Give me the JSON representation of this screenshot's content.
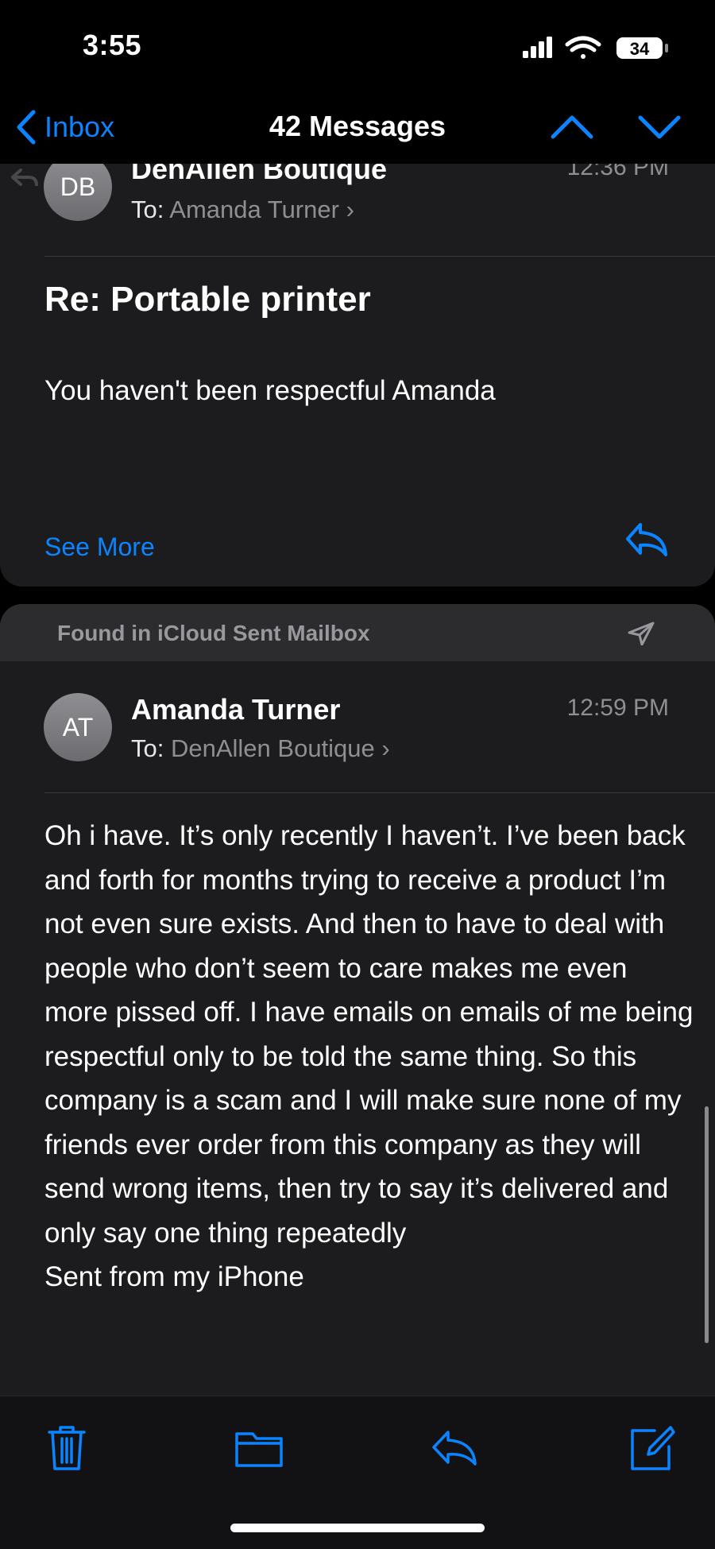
{
  "status_bar": {
    "time": "3:55",
    "battery": "34",
    "icons": [
      "signal-icon",
      "wifi-icon",
      "battery-icon"
    ]
  },
  "nav": {
    "back_label": "Inbox",
    "title": "42 Messages",
    "back_icon": "chevron-left-icon",
    "up_icon": "chevron-up-icon",
    "down_icon": "chevron-down-icon"
  },
  "message1": {
    "avatar_initials": "DB",
    "sender": "DenAllen Boutique",
    "to_label": "To:",
    "to_name": "Amanda Turner",
    "time": "12:36 PM",
    "subject": "Re: Portable printer",
    "preview": "You haven't been respectful Amanda",
    "see_more": "See More"
  },
  "found_banner": {
    "text": "Found in iCloud Sent Mailbox",
    "icon": "sent-icon"
  },
  "message2": {
    "avatar_initials": "AT",
    "sender": "Amanda Turner",
    "to_label": "To:",
    "to_name": "DenAllen Boutique",
    "time": "12:59 PM",
    "body": "Oh i have. It’s only recently I haven’t. I’ve been back and forth for months trying to receive a product I’m not even sure exists. And then to have to deal with people who don’t seem to care makes me even more pissed off. I have emails on emails of me being respectful only to be told the same thing. So this company is a scam and I will make sure none of my friends ever order from this company as they will send wrong items, then try to say it’s delivered and only say one thing repeatedly\nSent from my iPhone"
  },
  "toolbar": {
    "icons": [
      "trash-icon",
      "folder-icon",
      "reply-icon",
      "compose-icon"
    ]
  },
  "colors": {
    "accent": "#0a84ff",
    "card": "#1c1c1e",
    "secondary_text": "#8e8e93",
    "background": "#000000"
  }
}
